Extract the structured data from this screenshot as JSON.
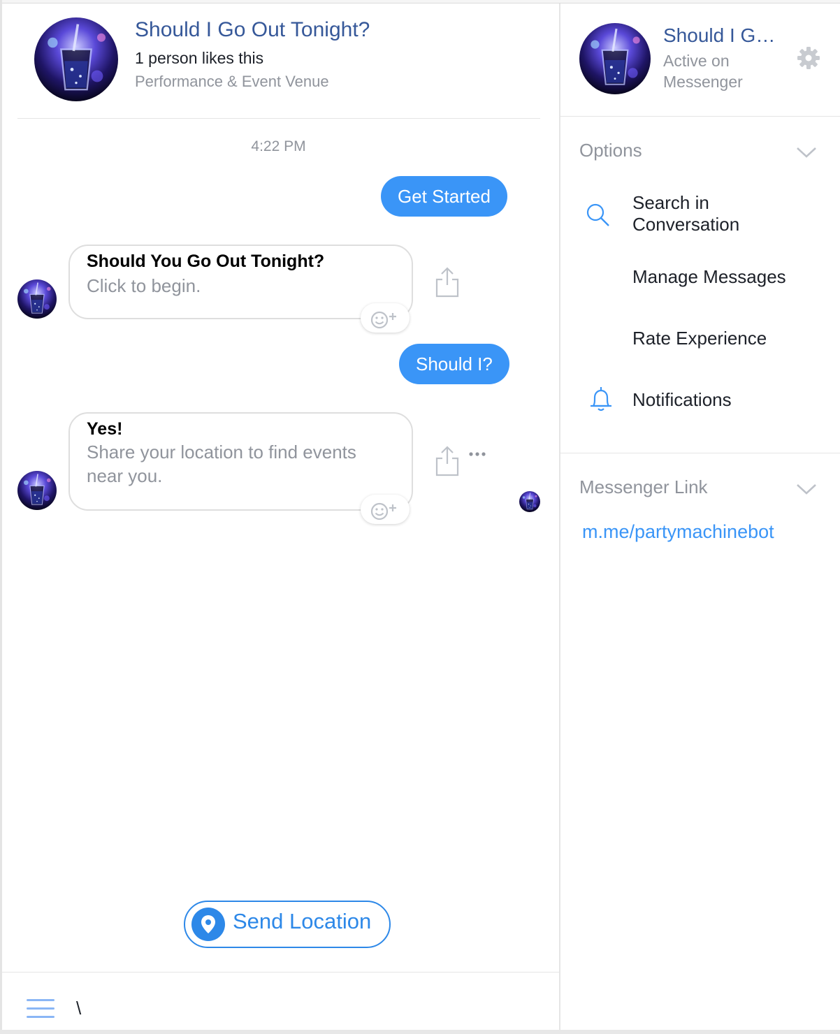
{
  "conversation": {
    "title": "Should I Go Out Tonight?",
    "likes": "1 person likes this",
    "category": "Performance & Event Venue",
    "avatar_icon": "night-drink-photo"
  },
  "messages": {
    "timestamp": "4:22 PM",
    "outgoing": [
      {
        "text": "Get Started"
      },
      {
        "text": "Should I?"
      }
    ],
    "cards": [
      {
        "title": "Should You Go Out Tonight?",
        "subtitle": "Click to begin."
      },
      {
        "title": "Yes!",
        "subtitle": "Share your location to find events near you."
      }
    ]
  },
  "quick_reply": {
    "label": "Send Location",
    "icon": "location-pin-icon"
  },
  "composer": {
    "value": "\\",
    "menu_icon": "hamburger-menu-icon"
  },
  "sidebar": {
    "title": "Should I Go Out Tonight?",
    "status": "Active on Messenger",
    "options_header": "Options",
    "options": [
      {
        "label": "Search in Conversation",
        "icon": "search-icon"
      },
      {
        "label": "Manage Messages",
        "icon": ""
      },
      {
        "label": "Rate Experience",
        "icon": ""
      },
      {
        "label": "Notifications",
        "icon": "bell-icon"
      }
    ],
    "link_header": "Messenger Link",
    "link": "m.me/partymachinebot"
  },
  "colors": {
    "brand_blue": "#3a95f7",
    "title_blue": "#365899",
    "muted_gray": "#90949c"
  }
}
